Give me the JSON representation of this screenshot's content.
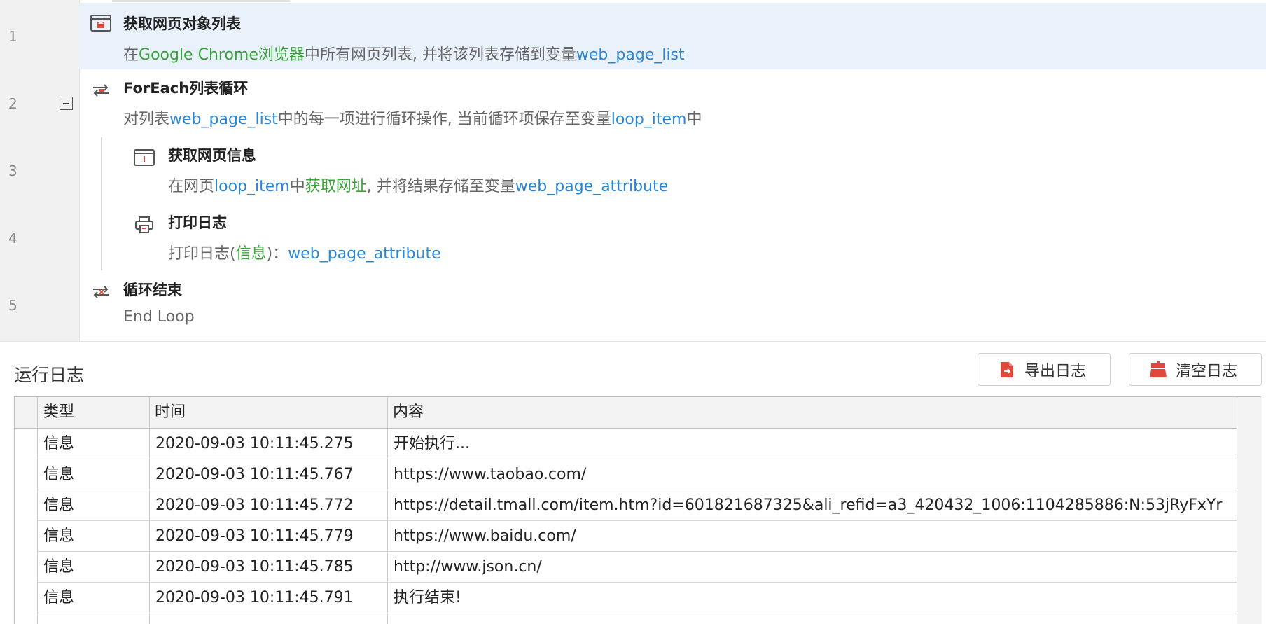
{
  "flow": {
    "line_numbers": [
      "1",
      "2",
      "3",
      "4",
      "5"
    ],
    "steps": [
      {
        "id": "get-webpage-list",
        "icon": "browser-upload-icon",
        "title": "获取网页对象列表",
        "desc": {
          "p1": "在",
          "browser": "Google Chrome浏览器",
          "p2": "中所有网页列表, 并将该列表存储到变量",
          "var": "web_page_list"
        }
      },
      {
        "id": "foreach-loop",
        "icon": "loop-icon",
        "title": "ForEach列表循环",
        "desc": {
          "p1": "对列表",
          "list": "web_page_list",
          "p2": "中的每一项进行循环操作, 当前循环项保存至变量",
          "var": "loop_item",
          "p3": "中"
        }
      },
      {
        "id": "get-webpage-info",
        "icon": "browser-info-icon",
        "title": "获取网页信息",
        "desc": {
          "p1": "在网页",
          "item": "loop_item",
          "p2": "中",
          "action": "获取网址",
          "p3": ", 并将结果存储至变量",
          "var": "web_page_attribute"
        }
      },
      {
        "id": "print-log",
        "icon": "printer-icon",
        "title": "打印日志",
        "desc": {
          "p1": "打印日志(",
          "level": "信息",
          "p2": ")：",
          "var": "web_page_attribute"
        }
      },
      {
        "id": "loop-end",
        "icon": "loop-end-icon",
        "title": "循环结束",
        "desc": {
          "p1": "End Loop"
        }
      }
    ]
  },
  "log_panel": {
    "title": "运行日志",
    "export_button": "导出日志",
    "clear_button": "清空日志",
    "columns": [
      "类型",
      "时间",
      "内容"
    ],
    "rows": [
      {
        "type": "信息",
        "time": "2020-09-03 10:11:45.275",
        "content": "开始执行..."
      },
      {
        "type": "信息",
        "time": "2020-09-03 10:11:45.767",
        "content": "https://www.taobao.com/"
      },
      {
        "type": "信息",
        "time": "2020-09-03 10:11:45.772",
        "content": "https://detail.tmall.com/item.htm?id=601821687325&ali_refid=a3_420432_1006:1104285886:N:53jRyFxYr"
      },
      {
        "type": "信息",
        "time": "2020-09-03 10:11:45.779",
        "content": "https://www.baidu.com/"
      },
      {
        "type": "信息",
        "time": "2020-09-03 10:11:45.785",
        "content": "http://www.json.cn/"
      },
      {
        "type": "信息",
        "time": "2020-09-03 10:11:45.791",
        "content": "执行结束!"
      }
    ]
  },
  "colors": {
    "highlight_row": "#e9f1fb",
    "keyword_green": "#3aa33a",
    "keyword_blue": "#2a86d8",
    "button_icon_red": "#e0483c"
  }
}
